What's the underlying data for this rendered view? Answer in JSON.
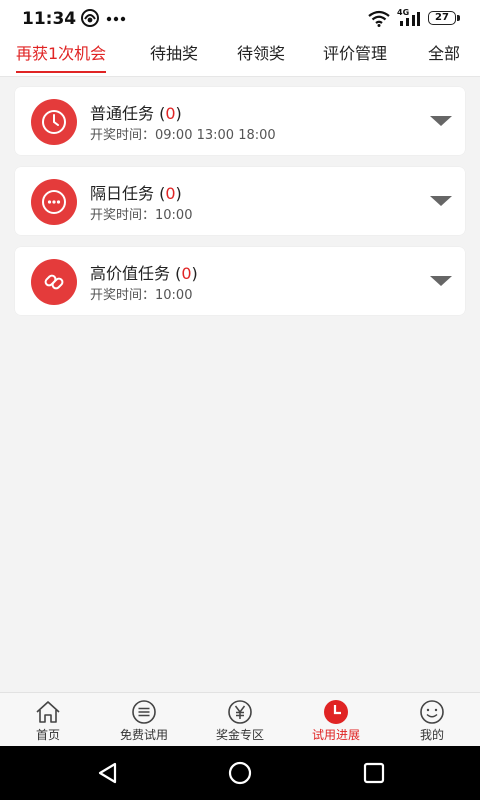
{
  "status_bar": {
    "time": "11:34",
    "network": "4G",
    "battery": "27"
  },
  "tabs": [
    {
      "label": "再获1次机会",
      "active": true
    },
    {
      "label": "待抽奖",
      "active": false
    },
    {
      "label": "待领奖",
      "active": false
    },
    {
      "label": "评价管理",
      "active": false
    },
    {
      "label": "全部",
      "active": false
    }
  ],
  "tasks": [
    {
      "name": "普通任务",
      "count_open": " (",
      "count": "0",
      "count_close": ")",
      "lottery_time": "开奖时间：09:00 13:00 18:00",
      "icon": "clock-icon"
    },
    {
      "name": "隔日任务",
      "count_open": " (",
      "count": "0",
      "count_close": ")",
      "lottery_time": "开奖时间：10:00",
      "icon": "more-dots-icon"
    },
    {
      "name": "高价值任务",
      "count_open": " (",
      "count": "0",
      "count_close": ")",
      "lottery_time": "开奖时间：10:00",
      "icon": "link-icon"
    }
  ],
  "bottom_nav": [
    {
      "label": "首页",
      "icon": "home-icon",
      "active": false
    },
    {
      "label": "免费试用",
      "icon": "list-icon",
      "active": false
    },
    {
      "label": "奖金专区",
      "icon": "yen-icon",
      "active": false
    },
    {
      "label": "试用进展",
      "icon": "progress-clock-icon",
      "active": true
    },
    {
      "label": "我的",
      "icon": "smiley-icon",
      "active": false
    }
  ],
  "colors": {
    "accent": "#e02424",
    "icon_bg": "#e43b3b",
    "background": "#f3f3f3"
  }
}
